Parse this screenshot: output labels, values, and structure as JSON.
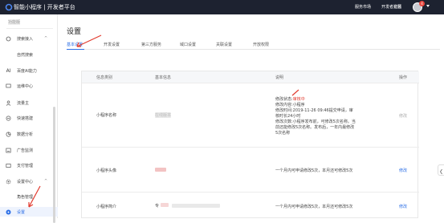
{
  "brand": {
    "title": "智能小程序 | 开发者平台"
  },
  "topnav": {
    "service": "服务市场",
    "community": "开发者社区",
    "docs": "文档",
    "badge": "4"
  },
  "sidebar": {
    "app_name": "功能版",
    "items": [
      {
        "label": "搜索接入",
        "chevron": "^"
      },
      {
        "label": "自然搜索"
      },
      {
        "label": "百度AI能力"
      },
      {
        "label": "运维中心"
      },
      {
        "label": "流量主"
      },
      {
        "label": "快速搭建"
      },
      {
        "label": "数据分析"
      },
      {
        "label": "广告监测"
      },
      {
        "label": "支付管理"
      },
      {
        "label": "设置中心",
        "chevron": "^"
      },
      {
        "label": "角色管理"
      },
      {
        "label": "设置"
      }
    ]
  },
  "page": {
    "title": "设置"
  },
  "tabs": [
    "基本设置",
    "开发设置",
    "第三方服务",
    "域口设置",
    "关联设置",
    "开放权限"
  ],
  "table": {
    "headers": [
      "信息类别",
      "基本信息",
      "说明",
      "操作"
    ],
    "rows": [
      {
        "category": "小程序名称",
        "info": "在线版本",
        "desc": {
          "status_prefix": "修改状态:",
          "status": "审核中",
          "content": "修改内容:小程序",
          "time": "修改时间:2019-11-26 09:46提交申请，审核时长24小时",
          "rule": "修改次数:小程序发布前，可修改5次名称。当前还能修改5次名称。发布后，一年内最修改5次名称"
        },
        "op": "修改"
      },
      {
        "category": "小程序头像",
        "desc": "一个月内可申请修改5次，本月还可修改5次",
        "op": "修改"
      },
      {
        "category": "小程序简介",
        "info": "专",
        "desc": "一个月内可申请修改5次，本月还可修改5次",
        "op": "修改"
      }
    ]
  },
  "colors": {
    "accent": "#2b6ee6",
    "topbar": "#1d2230",
    "annotation": "#e23b2f"
  }
}
